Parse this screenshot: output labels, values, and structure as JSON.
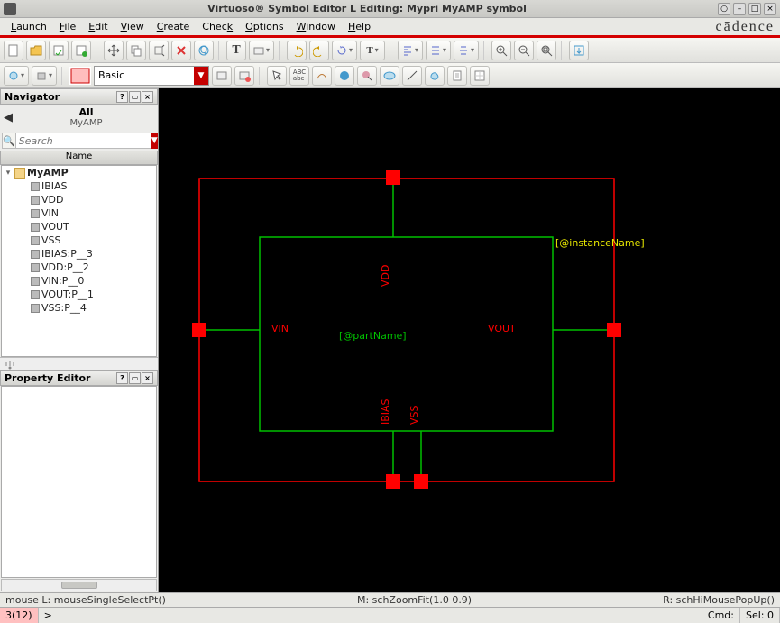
{
  "title": "Virtuoso® Symbol Editor L Editing: Mypri MyAMP symbol",
  "brand": "cādence",
  "menu": [
    "Launch",
    "File",
    "Edit",
    "View",
    "Create",
    "Check",
    "Options",
    "Window",
    "Help"
  ],
  "layer_combo": "Basic",
  "navigator": {
    "title": "Navigator",
    "all": "All",
    "lib": "MyAMP",
    "search_placeholder": "Search",
    "listhdr": "Name",
    "root": "MyAMP",
    "items": [
      "IBIAS",
      "VDD",
      "VIN",
      "VOUT",
      "VSS",
      "IBIAS:P__3",
      "VDD:P__2",
      "VIN:P__0",
      "VOUT:P__1",
      "VSS:P__4"
    ]
  },
  "propeditor": {
    "title": "Property Editor"
  },
  "canvas": {
    "instanceName": "[@instanceName]",
    "partName": "[@partName]",
    "labels": {
      "vdd": "VDD",
      "vin": "VIN",
      "vout": "VOUT",
      "ibias": "IBIAS",
      "vss": "VSS"
    }
  },
  "status": {
    "left": "mouse L: mouseSingleSelectPt()",
    "mid": "M: schZoomFit(1.0 0.9)",
    "right": "R: schHiMousePopUp()",
    "cell0": "3(12)",
    "prompt": ">",
    "cmd": "Cmd:",
    "sel": "Sel: 0"
  }
}
